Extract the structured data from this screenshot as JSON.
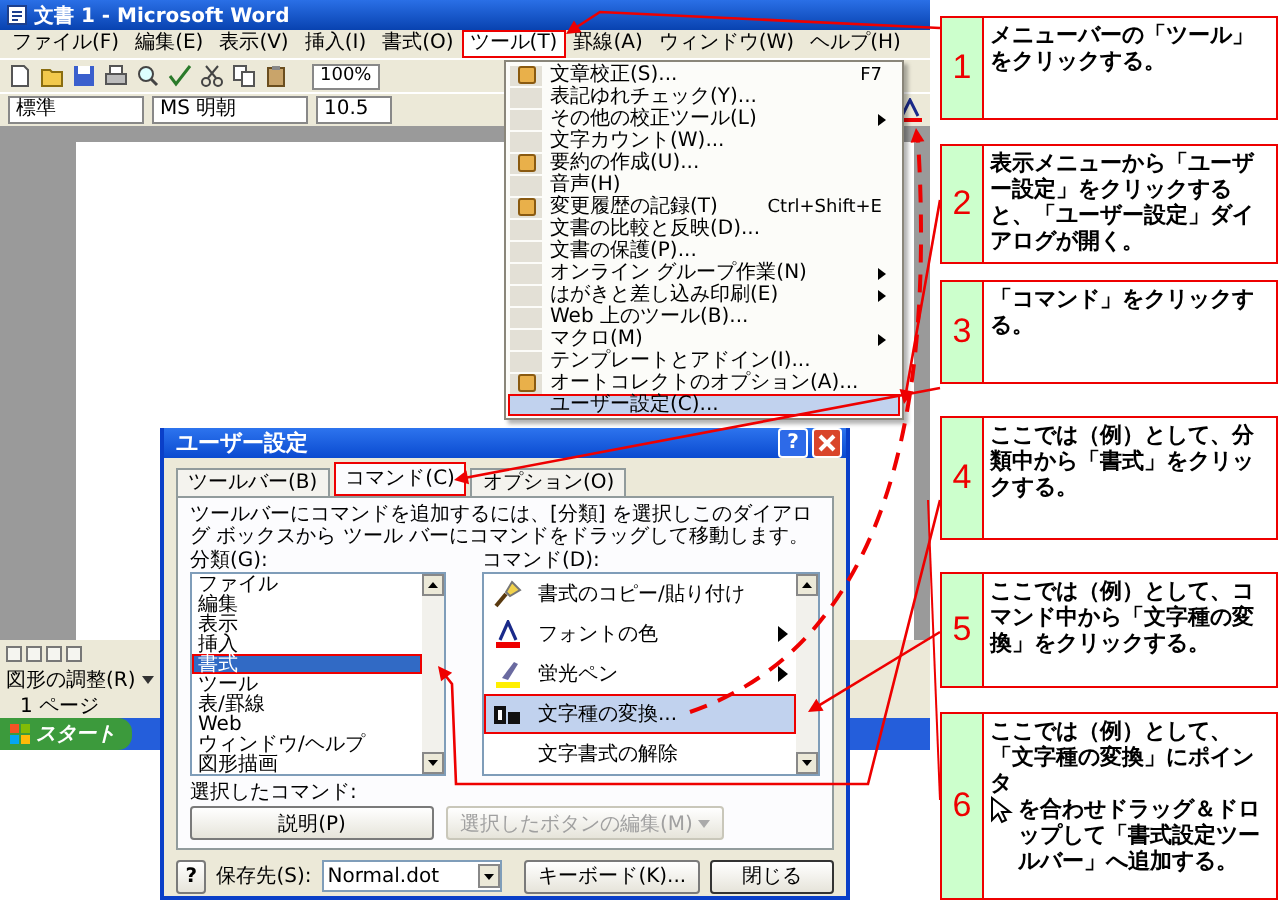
{
  "word_window": {
    "title": "文書 1 - Microsoft Word",
    "menu_bar": [
      {
        "label": "ファイル(F)",
        "selected": false
      },
      {
        "label": "編集(E)",
        "selected": false
      },
      {
        "label": "表示(V)",
        "selected": false
      },
      {
        "label": "挿入(I)",
        "selected": false
      },
      {
        "label": "書式(O)",
        "selected": false
      },
      {
        "label": "ツール(T)",
        "selected": true
      },
      {
        "label": "罫線(A)",
        "selected": false
      },
      {
        "label": "ウィンドウ(W)",
        "selected": false
      },
      {
        "label": "ヘルプ(H)",
        "selected": false
      }
    ],
    "standard_toolbar": {
      "zoom": "100%"
    },
    "formatting_toolbar": {
      "style": "標準",
      "font": "MS 明朝",
      "size": "10.5"
    },
    "drawing_toolbar": {
      "label": "図形の調整(R)"
    },
    "status_bar": {
      "page": "1 ページ"
    },
    "taskbar": {
      "start": "スタート"
    }
  },
  "tools_menu": {
    "items": [
      {
        "label": "文章校正(S)...",
        "shortcut": "F7",
        "has_icon": true,
        "submenu": false,
        "selected": false
      },
      {
        "label": "表記ゆれチェック(Y)...",
        "has_icon": false,
        "submenu": false,
        "selected": false
      },
      {
        "label": "その他の校正ツール(L)",
        "has_icon": false,
        "submenu": true,
        "selected": false
      },
      {
        "label": "文字カウント(W)...",
        "has_icon": false,
        "submenu": false,
        "selected": false
      },
      {
        "label": "要約の作成(U)...",
        "has_icon": true,
        "submenu": false,
        "selected": false
      },
      {
        "label": "音声(H)",
        "has_icon": false,
        "submenu": false,
        "selected": false
      },
      {
        "label": "変更履歴の記録(T)",
        "shortcut": "Ctrl+Shift+E",
        "has_icon": true,
        "submenu": false,
        "selected": false
      },
      {
        "label": "文書の比較と反映(D)...",
        "has_icon": false,
        "submenu": false,
        "selected": false
      },
      {
        "label": "文書の保護(P)...",
        "has_icon": false,
        "submenu": false,
        "selected": false
      },
      {
        "label": "オンライン グループ作業(N)",
        "has_icon": false,
        "submenu": true,
        "selected": false
      },
      {
        "label": "はがきと差し込み印刷(E)",
        "has_icon": false,
        "submenu": true,
        "selected": false
      },
      {
        "label": "Web 上のツール(B)...",
        "has_icon": false,
        "submenu": false,
        "selected": false
      },
      {
        "label": "マクロ(M)",
        "has_icon": false,
        "submenu": true,
        "selected": false
      },
      {
        "label": "テンプレートとアドイン(I)...",
        "has_icon": false,
        "submenu": false,
        "selected": false
      },
      {
        "label": "オートコレクトのオプション(A)...",
        "has_icon": true,
        "submenu": false,
        "selected": false
      },
      {
        "label": "ユーザー設定(C)...",
        "has_icon": false,
        "submenu": false,
        "selected": true
      }
    ]
  },
  "dialog": {
    "title": "ユーザー設定",
    "help_button": "?",
    "tabs": [
      {
        "label": "ツールバー(B)",
        "selected": false
      },
      {
        "label": "コマンド(C)",
        "selected": true
      },
      {
        "label": "オプション(O)",
        "selected": false
      }
    ],
    "instruction": "ツールバーにコマンドを追加するには、[分類] を選択しこのダイアログ ボックスから ツール バーにコマンドをドラッグして移動します。",
    "categories_label": "分類(G):",
    "categories": [
      {
        "label": "ファイル",
        "selected": false
      },
      {
        "label": "編集",
        "selected": false
      },
      {
        "label": "表示",
        "selected": false
      },
      {
        "label": "挿入",
        "selected": false
      },
      {
        "label": "書式",
        "selected": true
      },
      {
        "label": "ツール",
        "selected": false
      },
      {
        "label": "表/罫線",
        "selected": false
      },
      {
        "label": "Web",
        "selected": false
      },
      {
        "label": "ウィンドウ/ヘルプ",
        "selected": false
      },
      {
        "label": "図形描画",
        "selected": false
      }
    ],
    "commands_label": "コマンド(D):",
    "commands": [
      {
        "label": "書式のコピー/貼り付け",
        "has_icon": true,
        "submenu": false,
        "selected": false
      },
      {
        "label": "フォントの色",
        "has_icon": true,
        "submenu": true,
        "selected": false
      },
      {
        "label": "蛍光ペン",
        "has_icon": true,
        "submenu": true,
        "selected": false
      },
      {
        "label": "文字種の変換...",
        "has_icon": true,
        "submenu": false,
        "selected": true
      },
      {
        "label": "文字書式の解除",
        "has_icon": false,
        "submenu": false,
        "selected": false
      }
    ],
    "selected_command_label": "選択したコマンド:",
    "buttons": [
      {
        "label": "説明(P)",
        "disabled": false,
        "dropdown": false
      },
      {
        "label": "選択したボタンの編集(M)",
        "disabled": true,
        "dropdown": true
      }
    ],
    "footer": {
      "help": "?",
      "save_in_label": "保存先(S):",
      "save_in": "Normal.dot",
      "keyboard": "キーボード(K)...",
      "close": "閉じる"
    }
  },
  "callouts": [
    {
      "number": "1",
      "text": "メニューバーの「ツール」をクリックする。"
    },
    {
      "number": "2",
      "text": "表示メニューから「ユーザー設定」をクリックすると、「ユーザー設定」ダイアログが開く。"
    },
    {
      "number": "3",
      "text": "「コマンド」をクリックする。"
    },
    {
      "number": "4",
      "text": "ここでは（例）として、分類中から「書式」をクリックする。"
    },
    {
      "number": "5",
      "text": "ここでは（例）として、コマンド中から「文字種の変換」をクリックする。"
    },
    {
      "number": "6",
      "text": "ここでは（例）として、「文字種の変換」にポインタ",
      "text_after": "を合わせドラッグ＆ドロップして「書式設定ツールバー」へ追加する。"
    }
  ]
}
